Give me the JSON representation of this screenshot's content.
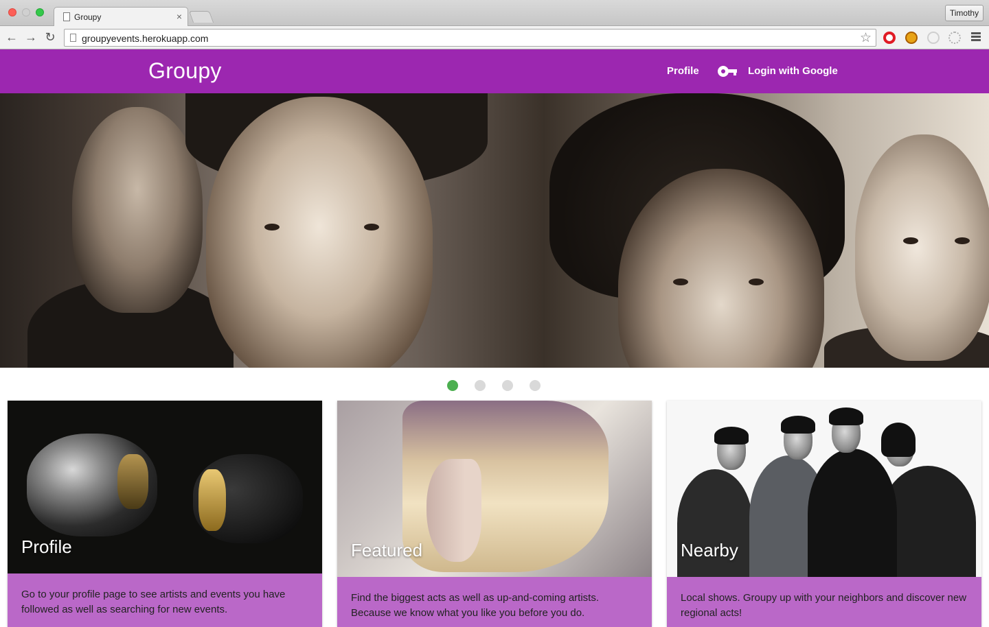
{
  "browser": {
    "tab_title": "Groupy",
    "tab_close": "×",
    "url": "groupyevents.herokuapp.com",
    "user": "Timothy",
    "nav_back": "←",
    "nav_forward": "→",
    "nav_reload": "↻",
    "star": "☆"
  },
  "header": {
    "brand": "Groupy",
    "nav_profile": "Profile",
    "nav_login": "Login with Google",
    "color": "#9c27b0"
  },
  "carousel": {
    "slide_count": 4,
    "active_index": 0,
    "active_color": "#4caf50"
  },
  "cards": [
    {
      "title": "Profile",
      "text": "Go to your profile page to see artists and events you have followed as well as searching for new events."
    },
    {
      "title": "Featured",
      "text": "Find the biggest acts as well as up-and-coming artists. Because we know what you like you before you do."
    },
    {
      "title": "Nearby",
      "text": "Local shows. Groupy up with your neighbors and discover new regional acts!"
    }
  ],
  "card_body_color": "#ba68c8"
}
